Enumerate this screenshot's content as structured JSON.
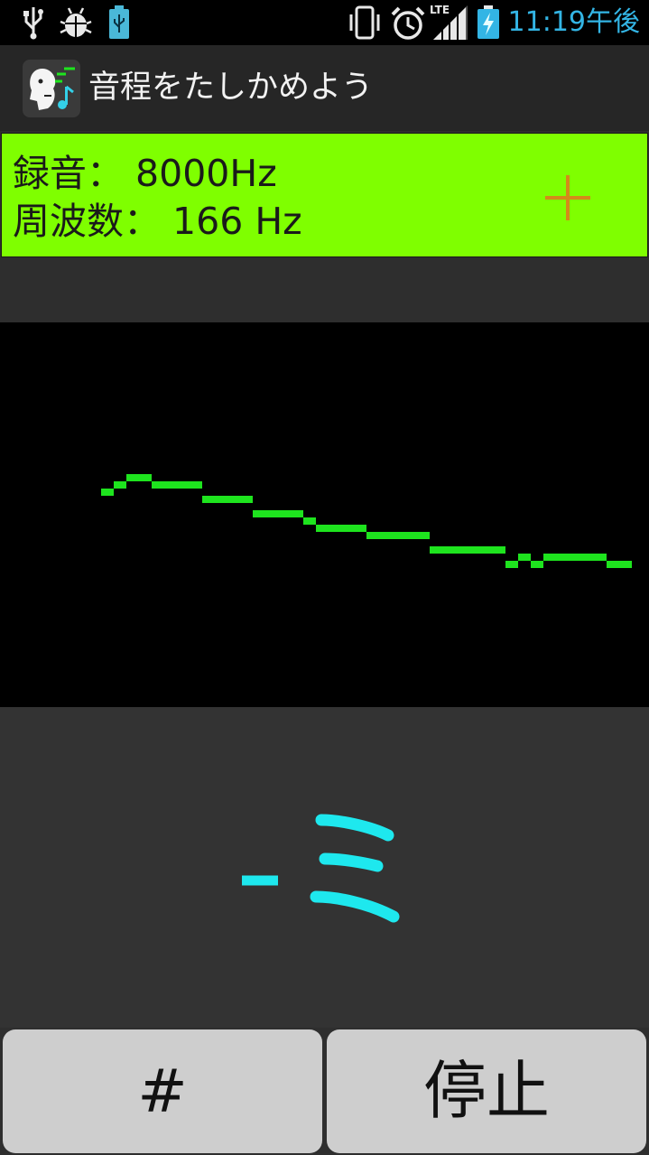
{
  "status_bar": {
    "icons": [
      "usb-icon",
      "debug-bug-icon",
      "battery-usb-icon",
      "vibrate-icon",
      "alarm-icon",
      "lte-signal-icon",
      "battery-charging-icon"
    ],
    "network_label": "LTE",
    "time": "11:19午後"
  },
  "app": {
    "icon": "singing-face-music-note-icon",
    "title": "音程をたしかめよう"
  },
  "info": {
    "recording": "録音： 8000Hz",
    "frequency": "周波数： 166 Hz",
    "plus_icon": "plus-icon"
  },
  "note": {
    "text": "-ミ",
    "color": "#1ee8ee"
  },
  "buttons": {
    "sharp": "#",
    "stop": "停止"
  },
  "colors": {
    "accent_panel": "#7fff00",
    "pitch_line": "#1ee41e",
    "plus_icon": "#d48a1a",
    "clock": "#33b5e5"
  }
}
